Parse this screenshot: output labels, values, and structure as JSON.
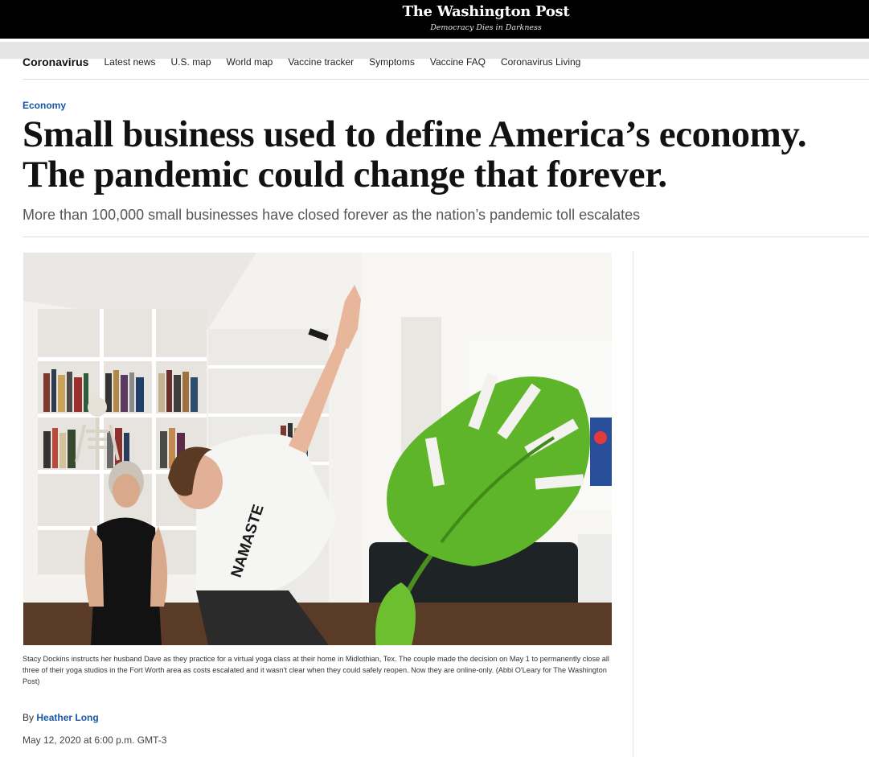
{
  "masthead": {
    "title": "The Washington Post",
    "tagline": "Democracy Dies in Darkness"
  },
  "nav": {
    "section": "Coronavirus",
    "links": [
      "Latest news",
      "U.S. map",
      "World map",
      "Vaccine tracker",
      "Symptoms",
      "Vaccine FAQ",
      "Coronavirus Living"
    ]
  },
  "article": {
    "kicker": "Economy",
    "headline": "Small business used to define America’s economy. The pandemic could change that forever.",
    "dek": "More than 100,000 small businesses have closed forever as the nation’s pandemic toll escalates",
    "photo": {
      "shirt_text": "NAMASTE"
    },
    "caption": "Stacy Dockins instructs her husband Dave as they practice for a virtual yoga class at their home in Midlothian, Tex. The couple made the decision on May 1 to permanently close all three of their yoga studios in the Fort Worth area as costs escalated and it wasn't clear when they could safely reopen. Now they are online-only. (Abbi O'Leary for The Washington Post)",
    "byline_prefix": "By",
    "author": "Heather Long",
    "date": "May 12, 2020 at 6:00 p.m. GMT-3"
  },
  "colors": {
    "masthead_bg": "#000000",
    "link_blue": "#1955a5",
    "plant_green": "#5fb52a"
  }
}
